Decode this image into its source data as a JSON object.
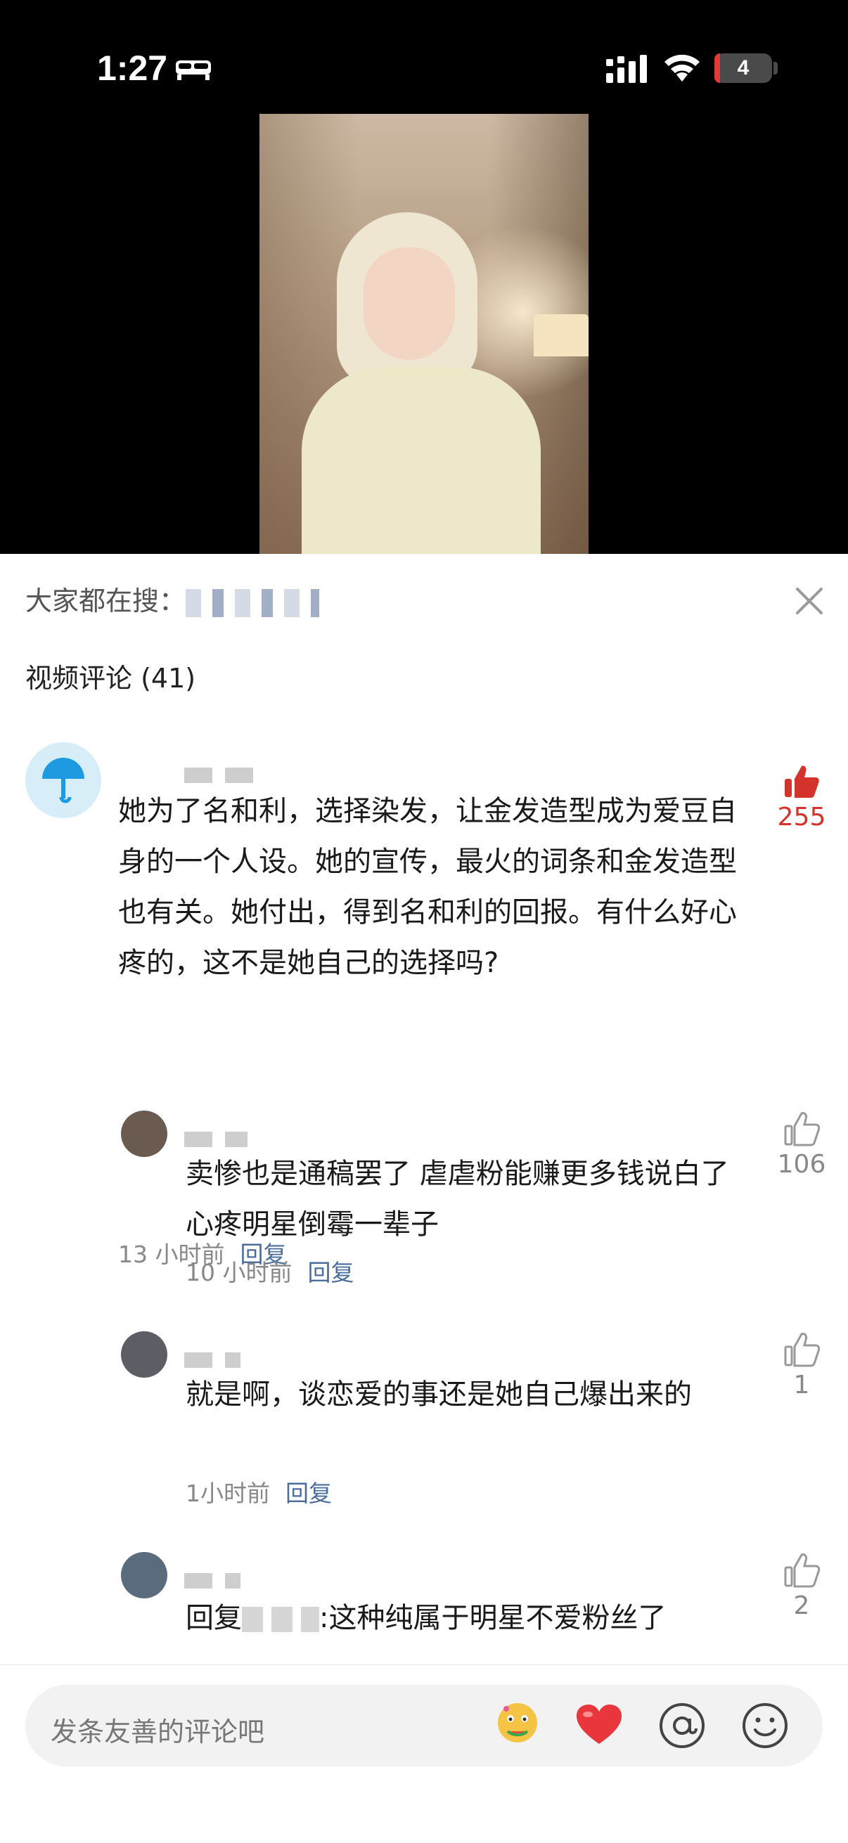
{
  "status_bar": {
    "time": "1:27",
    "battery_level": "4",
    "icons": [
      "bed-icon",
      "signal-icon",
      "wifi-icon",
      "battery-icon"
    ]
  },
  "sheet": {
    "trending_label": "大家都在搜：",
    "comments_title": "视频评论 (41)"
  },
  "comments": [
    {
      "text": "她为了名和利，选择染发，让金发造型成为爱豆自身的一个人设。她的宣传，最火的词条和金发造型也有关。她付出，得到名和利的回报。有什么好心疼的，这不是她自己的选择吗?",
      "time": "13 小时前",
      "reply_label": "回复",
      "likes": "255",
      "liked": true
    }
  ],
  "replies": [
    {
      "text": "卖惨也是通稿罢了 虐虐粉能赚更多钱说白了心疼明星倒霉一辈子",
      "time": "10 小时前",
      "reply_label": "回复",
      "likes": "106"
    },
    {
      "text": "就是啊，谈恋爱的事还是她自己爆出来的",
      "time": "1小时前",
      "reply_label": "回复",
      "likes": "1"
    },
    {
      "text_prefix": "回复",
      "text_suffix": ":这种纯属于明星不爱粉丝了",
      "likes": "2"
    }
  ],
  "input": {
    "placeholder": "发条友善的评论吧",
    "icons": [
      "melon-emoji-icon",
      "heart-icon",
      "at-icon",
      "smiley-icon"
    ]
  },
  "colors": {
    "accent_red": "#d4332b",
    "reply_link": "#4a6d9c"
  }
}
